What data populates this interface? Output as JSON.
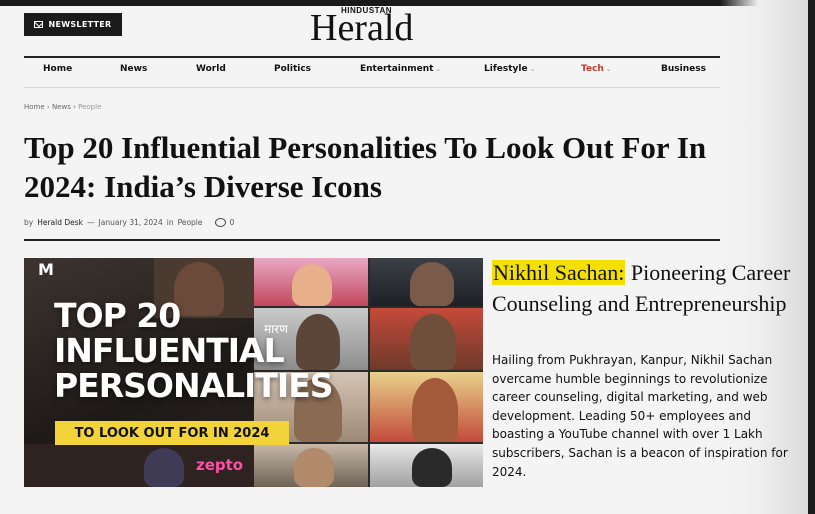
{
  "header": {
    "newsletter_label": "NEWSLETTER",
    "logo_small": "HINDUSTAN",
    "logo_main": "Herald"
  },
  "nav": {
    "items": [
      {
        "label": "Home"
      },
      {
        "label": "News"
      },
      {
        "label": "World"
      },
      {
        "label": "Politics"
      },
      {
        "label": "Entertainment"
      },
      {
        "label": "Lifestyle"
      },
      {
        "label": "Tech"
      },
      {
        "label": "Business"
      }
    ],
    "accent_color": "#c0392b"
  },
  "breadcrumb": [
    "Home",
    "News",
    "People"
  ],
  "article": {
    "title": "Top 20 Influential Personalities To Look Out For In 2024: India’s Diverse Icons",
    "meta": {
      "by": "by",
      "author": "Herald Desk",
      "dash": "—",
      "date": "January 31, 2024",
      "in": "in",
      "category": "People",
      "comments": "0"
    }
  },
  "featured_image": {
    "logo_mark": "M",
    "headline_line1": "TOP 20",
    "headline_line2": "INFLUENTIAL",
    "headline_line3": "PERSONALITIES",
    "banner": "TO LOOK OUT FOR IN 2024",
    "brand_text": "zepto",
    "hindi_text": "मारण"
  },
  "side_article": {
    "name_highlight": "Nikhil Sachan:",
    "heading_rest": " Pioneering Career Counseling and Entrepreneurship",
    "body": "Hailing from Pukhrayan, Kanpur, Nikhil Sachan overcame humble beginnings to revolutionize career counseling, digital marketing, and web development. Leading 50+ employees and boasting a YouTube channel with over 1 Lakh subscribers, Sachan is a beacon of inspiration for 2024.",
    "highlight_color": "#f3e000"
  }
}
